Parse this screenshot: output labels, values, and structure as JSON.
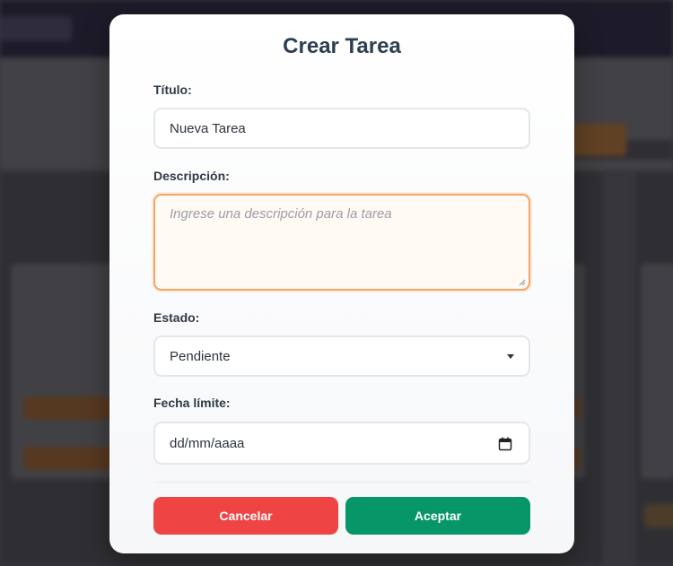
{
  "modal": {
    "title": "Crear Tarea",
    "fields": {
      "title": {
        "label": "Título:",
        "value": "Nueva Tarea"
      },
      "description": {
        "label": "Descripción:",
        "placeholder": "Ingrese una descripción para la tarea"
      },
      "status": {
        "label": "Estado:",
        "selected": "Pendiente"
      },
      "due_date": {
        "label": "Fecha límite:",
        "placeholder": "dd/mm/aaaa"
      }
    },
    "buttons": {
      "cancel": "Cancelar",
      "accept": "Aceptar"
    }
  },
  "colors": {
    "cancel": "#ef4444",
    "accept": "#069667",
    "focus_border": "#f2a565",
    "title": "#2d3e50"
  },
  "icons": {
    "select": "chevron-down-icon",
    "date": "calendar-icon"
  }
}
